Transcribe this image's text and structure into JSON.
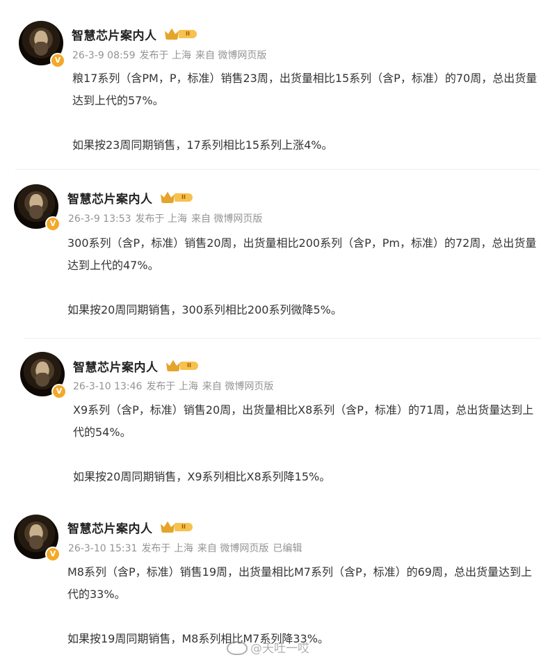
{
  "posts": [
    {
      "username": "智慧芯片案内人",
      "rank_badge": "II",
      "verified_mark": "V",
      "date": "26-3-9 08:59",
      "location": "发布于 上海",
      "source": "来自 微博网页版",
      "edited": "",
      "paragraphs": [
        "粮17系列（含PM，P，标准）销售23周，出货量相比15系列（含P，标准）的70周，总出货量达到上代的57%。",
        "如果按23周同期销售，17系列相比15系列上涨4%。"
      ]
    },
    {
      "username": "智慧芯片案内人",
      "rank_badge": "II",
      "verified_mark": "V",
      "date": "26-3-9 13:53",
      "location": "发布于 上海",
      "source": "来自 微博网页版",
      "edited": "",
      "paragraphs": [
        "300系列（含P，标准）销售20周，出货量相比200系列（含P，Pm，标准）的72周，总出货量达到上代的47%。",
        "如果按20周同期销售，300系列相比200系列微降5%。"
      ]
    },
    {
      "username": "智慧芯片案内人",
      "rank_badge": "II",
      "verified_mark": "V",
      "date": "26-3-10 13:46",
      "location": "发布于 上海",
      "source": "来自 微博网页版",
      "edited": "",
      "paragraphs": [
        "X9系列（含P，标准）销售20周，出货量相比X8系列（含P，标准）的71周，总出货量达到上代的54%。",
        "如果按20周同期销售，X9系列相比X8系列降15%。"
      ]
    },
    {
      "username": "智慧芯片案内人",
      "rank_badge": "II",
      "verified_mark": "V",
      "date": "26-3-10 15:31",
      "location": "发布于 上海",
      "source": "来自 微博网页版",
      "edited": "已编辑",
      "paragraphs": [
        "M8系列（含P，标准）销售19周，出货量相比M7系列（含P，标准）的69周，总出货量达到上代的33%。",
        "如果按19周同期销售，M8系列相比M7系列降33%。"
      ]
    }
  ],
  "watermark": "@天吐一哎",
  "colors": {
    "text": "#333333",
    "meta": "#939393",
    "badge": "#f4a82a",
    "divider": "#eeeeee"
  },
  "icons": {
    "verified": "verified-badge-icon",
    "rank": "crown-rank-icon",
    "weibo": "weibo-logo-icon"
  }
}
